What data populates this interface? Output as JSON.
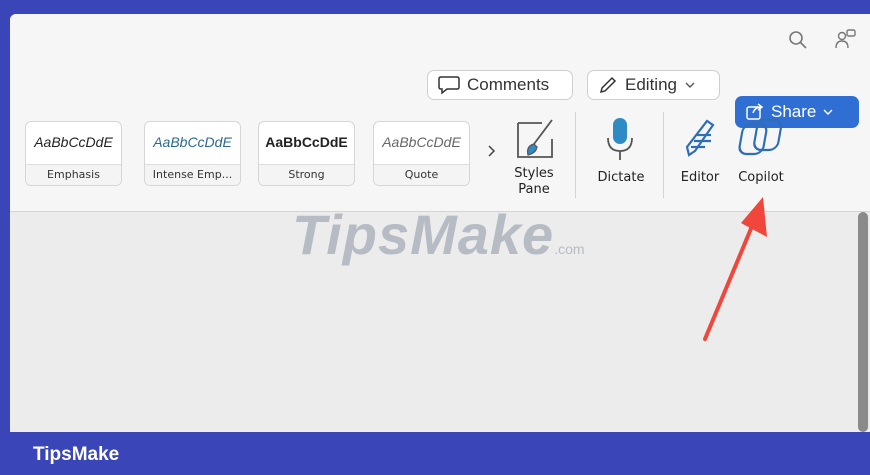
{
  "toolbar": {
    "comments_label": "Comments",
    "editing_label": "Editing",
    "share_label": "Share"
  },
  "styles": [
    {
      "sample": "AaBbCcDdE",
      "name": "Emphasis"
    },
    {
      "sample": "AaBbCcDdE",
      "name": "Intense Emp..."
    },
    {
      "sample": "AaBbCcDdE",
      "name": "Strong"
    },
    {
      "sample": "AaBbCcDdE",
      "name": "Quote"
    }
  ],
  "tools": {
    "styles_pane_line1": "Styles",
    "styles_pane_line2": "Pane",
    "dictate": "Dictate",
    "editor": "Editor",
    "copilot": "Copilot"
  },
  "watermark": {
    "main": "TipsMake",
    "suffix": ".com"
  },
  "footer": {
    "brand": "TipsMake"
  },
  "colors": {
    "accent": "#2f6fd3",
    "footer_bg": "#3a45b8",
    "arrow": "#f0463c"
  }
}
